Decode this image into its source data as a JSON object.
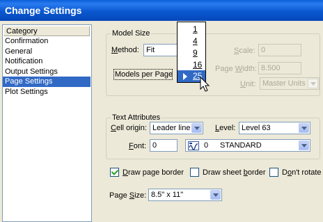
{
  "window": {
    "title": "Change Settings"
  },
  "category": {
    "header": "Category",
    "items": [
      "Confirmation",
      "General",
      "Notification",
      "Output Settings",
      "Page Settings",
      "Plot Settings"
    ],
    "selected_index": 4
  },
  "model_size": {
    "legend": "Model Size",
    "method_label": "Method:",
    "method_value": "Fit",
    "models_per_page_label": "Models per Page",
    "scale_label": "Scale:",
    "scale_value": "0",
    "page_width_label": "Page Width:",
    "page_width_value": "8.500",
    "unit_label": "Unit:",
    "unit_value": "Master Units"
  },
  "models_per_page_menu": {
    "options": [
      "1",
      "4",
      "9",
      "16",
      "25"
    ],
    "selected_index": 4
  },
  "text_attributes": {
    "legend": "Text Attributes",
    "cell_origin_label": "Cell origin:",
    "cell_origin_value": "Leader line",
    "level_label": "Level:",
    "level_value": "Level 63",
    "font_label": "Font:",
    "font_value": "0",
    "font_name_number": "0",
    "font_name": "STANDARD"
  },
  "options": {
    "draw_page_border_label": "Draw page border",
    "draw_page_border_checked": true,
    "draw_sheet_border_label": "Draw sheet border",
    "draw_sheet_border_checked": false,
    "dont_rotate_label": "Don't rotate",
    "dont_rotate_checked": false
  },
  "page_size": {
    "label": "Page Size:",
    "value": "8.5\" x 11\""
  },
  "icons": [
    "dropdown-arrow-icon",
    "font-type-icon",
    "menu-selection-arrow-icon",
    "mouse-pointer-icon"
  ]
}
